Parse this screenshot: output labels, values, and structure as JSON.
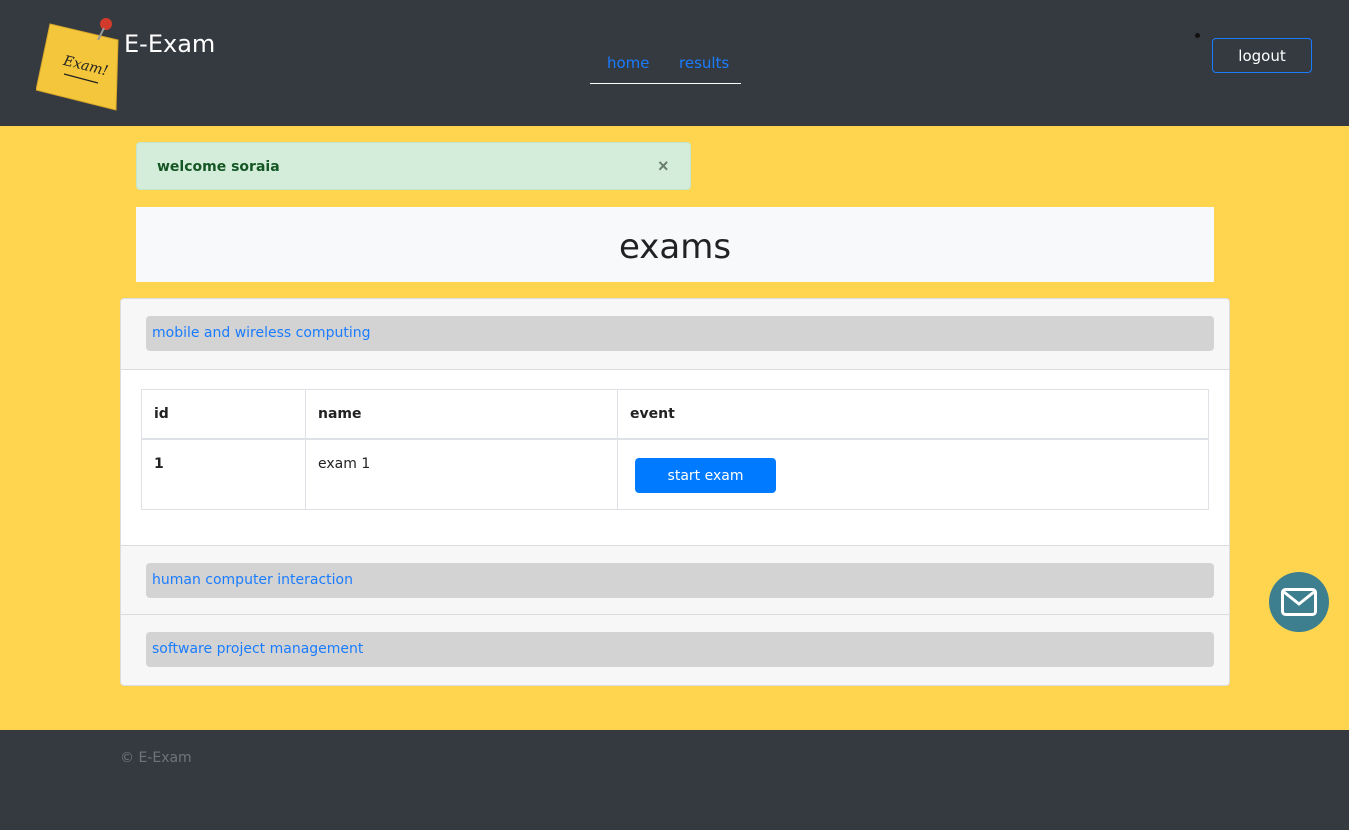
{
  "header": {
    "brand": "E-Exam",
    "logo_text": "Exam!",
    "nav": [
      {
        "label": "home"
      },
      {
        "label": "results"
      }
    ],
    "logout_label": "logout"
  },
  "alert": {
    "message": "welcome soraia",
    "close": "×"
  },
  "page_title": "exams",
  "subjects": [
    {
      "name": "mobile and wireless computing"
    },
    {
      "name": "human computer interaction"
    },
    {
      "name": "software project management"
    }
  ],
  "table": {
    "headers": [
      "id",
      "name",
      "event"
    ],
    "rows": [
      {
        "id": "1",
        "name": "exam 1",
        "action": "start exam"
      }
    ]
  },
  "footer": {
    "copyright": "© E-Exam"
  },
  "colors": {
    "header_bg": "#343a40",
    "page_bg": "#ffd54f",
    "accent": "#007bff",
    "alert_bg": "#d4edda",
    "mail_button": "#3d7f8f"
  },
  "icons": {
    "mail": "envelope-icon",
    "logo": "sticky-note-logo"
  }
}
